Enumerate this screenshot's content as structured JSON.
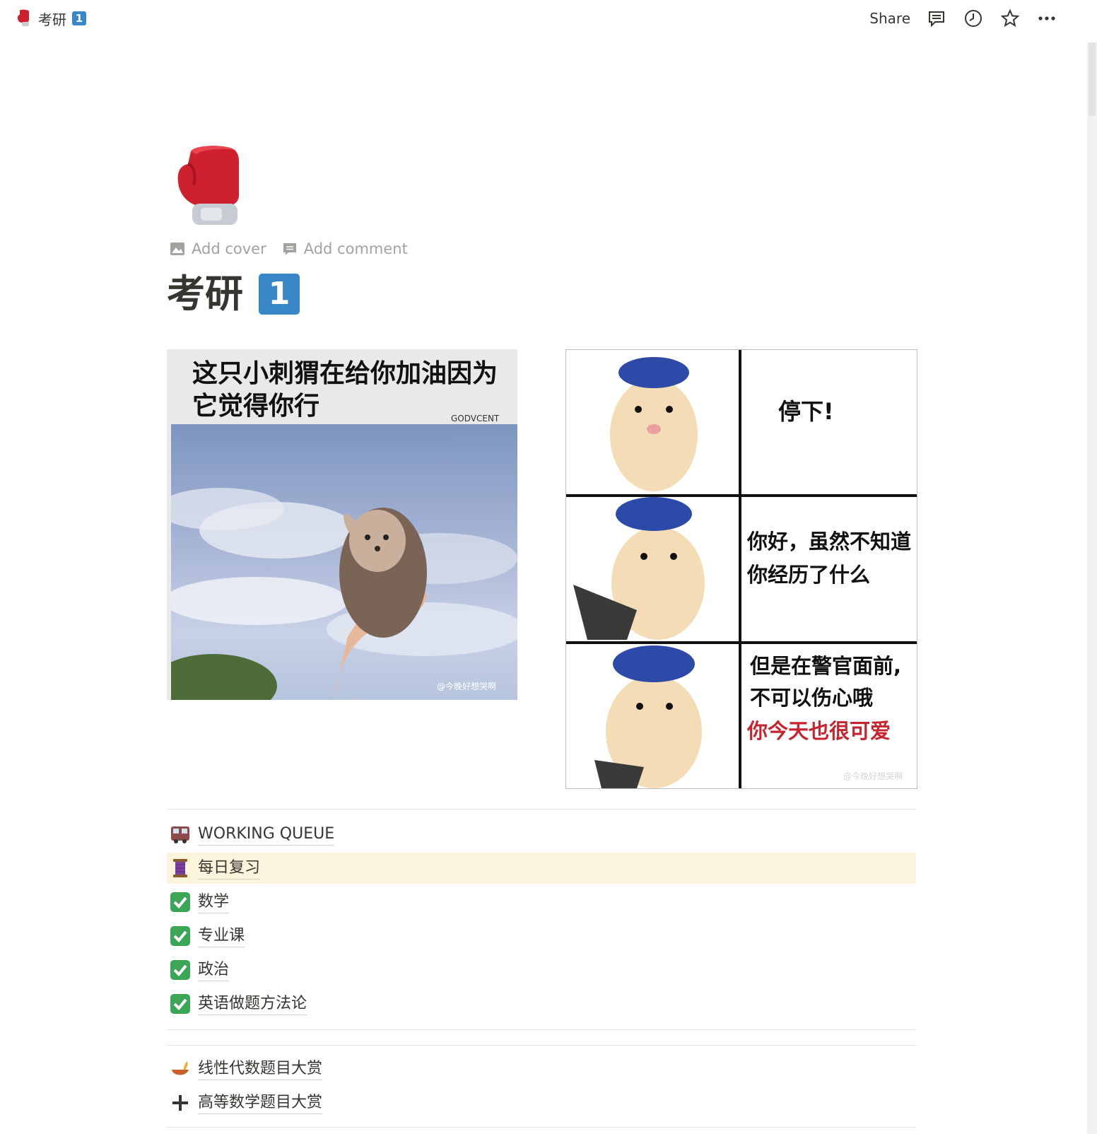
{
  "breadcrumb": {
    "title": "考研",
    "badge": "1"
  },
  "topbar": {
    "share_label": "Share",
    "icons": [
      "comment-icon",
      "history-icon",
      "star-icon",
      "more-icon"
    ]
  },
  "page": {
    "icon": "boxing-glove-icon",
    "add_cover_label": "Add cover",
    "add_comment_label": "Add comment",
    "title": "考研",
    "title_badge": "1"
  },
  "meme_left": {
    "caption": "这只小刺猬在给你加油因为它觉得你行",
    "corner_watermark": "GODVCENT",
    "bottom_watermark": "@今晚好想哭啊"
  },
  "meme_right": {
    "panel1": "停下!",
    "panel2_line1": "你好，虽然不知道",
    "panel2_line2": "你经历了什么",
    "panel3_line1": "但是在警官面前,",
    "panel3_line2": "不可以伤心哦",
    "panel3_line3": "你今天也很可爱",
    "watermark": "@今晚好想哭啊"
  },
  "working_queue": {
    "items": [
      {
        "icon": "train-icon",
        "label": "WORKING QUEUE",
        "highlight": false
      },
      {
        "icon": "thread-spool-icon",
        "label": "每日复习",
        "highlight": true
      },
      {
        "icon": "check-mark-icon",
        "label": "数学",
        "highlight": false
      },
      {
        "icon": "check-mark-icon",
        "label": "专业课",
        "highlight": false
      },
      {
        "icon": "check-mark-icon",
        "label": "政治",
        "highlight": false
      },
      {
        "icon": "check-mark-icon",
        "label": "英语做题方法论",
        "highlight": false
      }
    ]
  },
  "collections": {
    "items": [
      {
        "icon": "oil-lamp-icon",
        "label": "线性代数题目大赏"
      },
      {
        "icon": "plus-icon",
        "label": "高等数学题目大赏"
      }
    ]
  },
  "colors": {
    "highlight": "#fbf3db",
    "badge": "#3a87c8",
    "check": "#3aa757",
    "text": "#37352f",
    "muted": "#a3a29e"
  }
}
